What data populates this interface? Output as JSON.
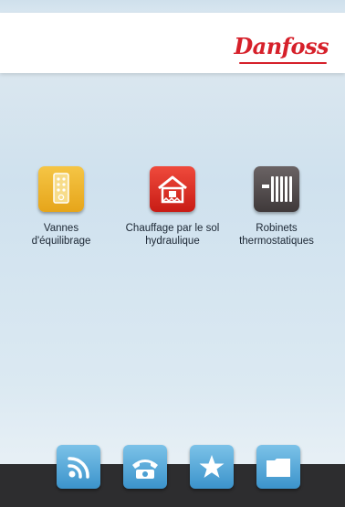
{
  "header": {
    "logo_text": "Danfoss"
  },
  "apps": [
    {
      "label_line1": "Vannes",
      "label_line2": "d'équilibrage",
      "icon": "balancing-valves-icon",
      "color": "#f0b530"
    },
    {
      "label_line1": "Chauffage par le sol",
      "label_line2": "hydraulique",
      "icon": "floor-heating-icon",
      "color": "#e2322a"
    },
    {
      "label_line1": "Robinets",
      "label_line2": "thermostatiques",
      "icon": "radiator-icon",
      "color": "#524b4c"
    }
  ],
  "dock": [
    {
      "icon": "rss-feed-icon"
    },
    {
      "icon": "phone-icon"
    },
    {
      "icon": "star-icon"
    },
    {
      "icon": "folder-icon"
    }
  ],
  "colors": {
    "brand": "#d6202a",
    "dock_button": "#4fa6d8",
    "bottom_bar": "#2d2d2f"
  }
}
